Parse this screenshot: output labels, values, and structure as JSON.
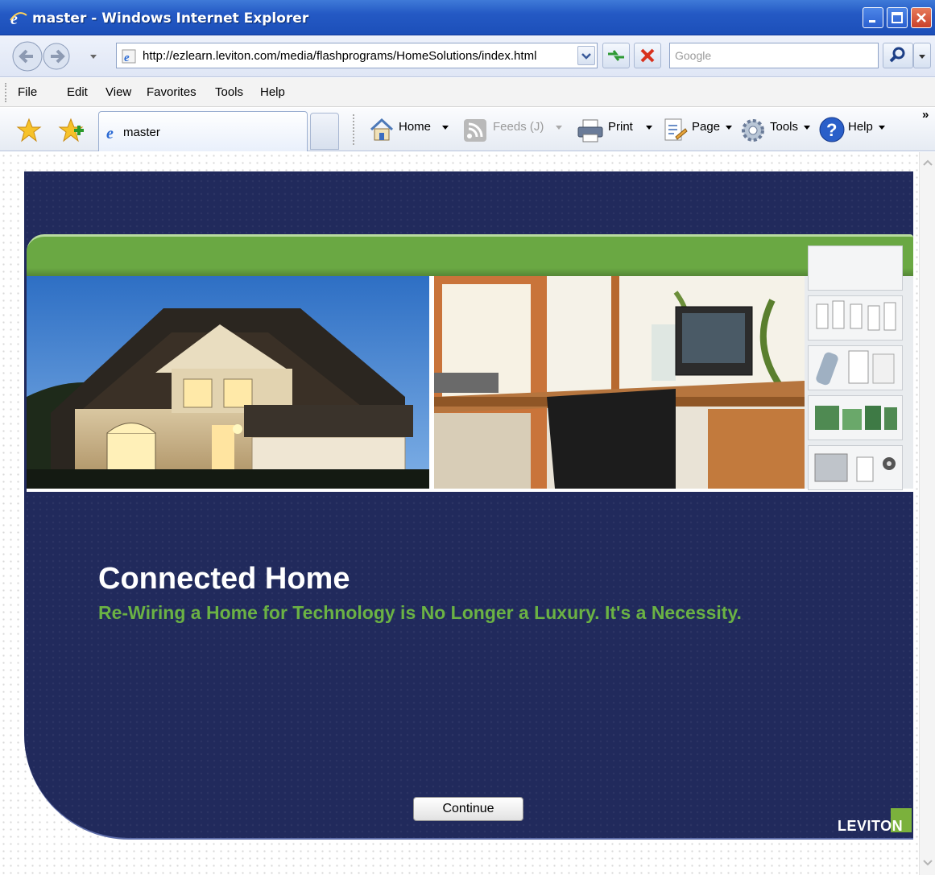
{
  "window": {
    "title": "master - Windows Internet Explorer"
  },
  "address_bar": {
    "url": "http://ezlearn.leviton.com/media/flashprograms/HomeSolutions/index.html",
    "search_placeholder": "Google"
  },
  "menu": {
    "items": [
      "File",
      "Edit",
      "View",
      "Favorites",
      "Tools",
      "Help"
    ]
  },
  "command_bar": {
    "tab_title": "master",
    "home": "Home",
    "feeds": "Feeds (J)",
    "print": "Print",
    "page": "Page",
    "tools": "Tools",
    "help": "Help",
    "overflow": "»"
  },
  "content": {
    "heading": "Connected Home",
    "subheading": "Re-Wiring a Home for Technology is No Longer a Luxury. It's a Necessity.",
    "continue_label": "Continue",
    "logo_text": "LEVITON"
  },
  "colors": {
    "stage": "#212a5c",
    "banner": "#6aa843",
    "subheading": "#6bb244",
    "titlebar": "#2459c4"
  }
}
